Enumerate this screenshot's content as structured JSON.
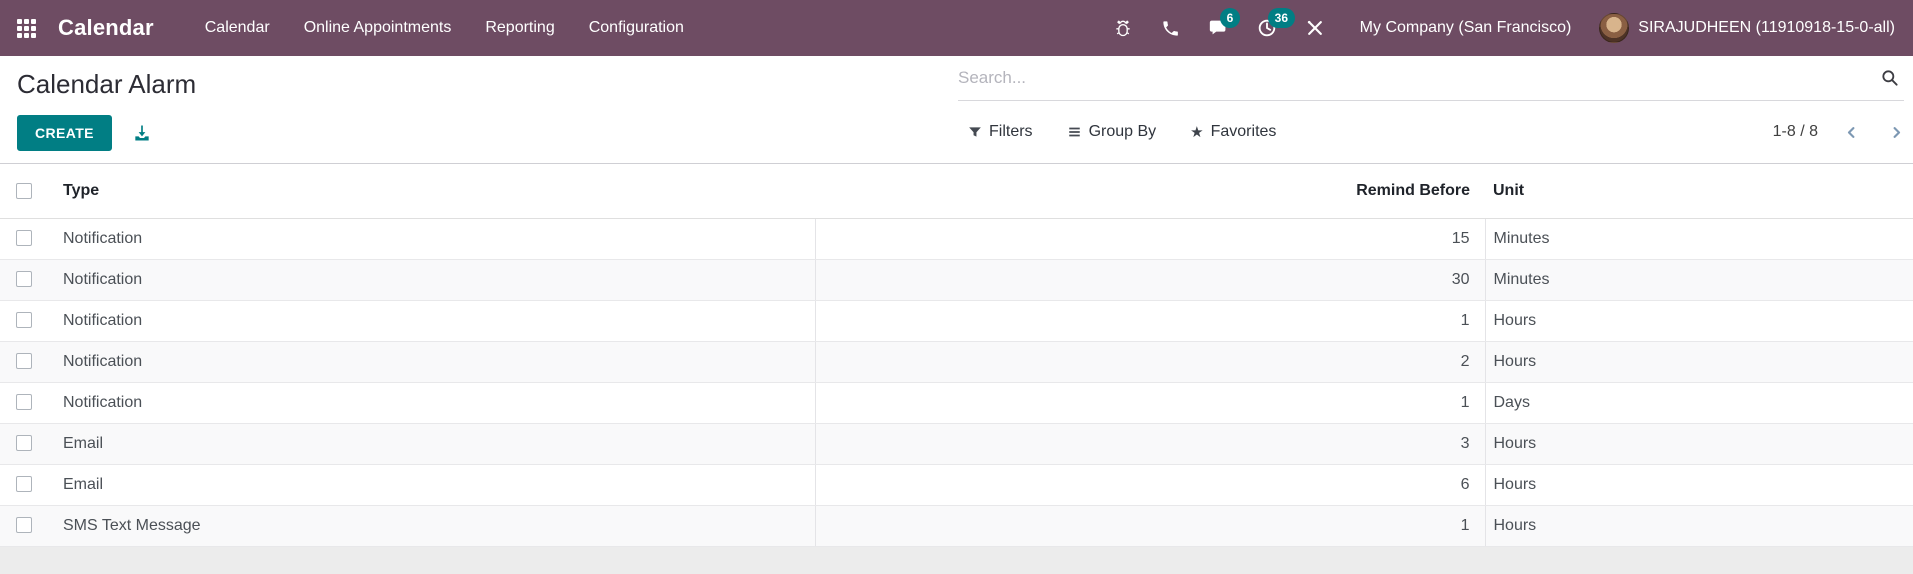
{
  "colors": {
    "navbar": "#6e4c63",
    "accent": "#017e84",
    "badge": "#017e84"
  },
  "navbar": {
    "app_name": "Calendar",
    "menu_items": [
      "Calendar",
      "Online Appointments",
      "Reporting",
      "Configuration"
    ],
    "icons": [
      "bug-icon",
      "phone-icon",
      "messages-icon",
      "activities-icon",
      "tools-icon"
    ],
    "messages_badge": "6",
    "activities_badge": "36",
    "company": "My Company (San Francisco)",
    "user": "SIRAJUDHEEN (11910918-15-0-all)"
  },
  "control_panel": {
    "title": "Calendar Alarm",
    "create_label": "CREATE",
    "search_placeholder": "Search...",
    "filters_label": "Filters",
    "group_by_label": "Group By",
    "favorites_label": "Favorites",
    "star_glyph": "★",
    "pager_value": "1-8 / 8"
  },
  "table": {
    "columns": {
      "type": "Type",
      "remind_before": "Remind Before",
      "unit": "Unit"
    },
    "rows": [
      {
        "type": "Notification",
        "remind_before": "15",
        "unit": "Minutes"
      },
      {
        "type": "Notification",
        "remind_before": "30",
        "unit": "Minutes"
      },
      {
        "type": "Notification",
        "remind_before": "1",
        "unit": "Hours"
      },
      {
        "type": "Notification",
        "remind_before": "2",
        "unit": "Hours"
      },
      {
        "type": "Notification",
        "remind_before": "1",
        "unit": "Days"
      },
      {
        "type": "Email",
        "remind_before": "3",
        "unit": "Hours"
      },
      {
        "type": "Email",
        "remind_before": "6",
        "unit": "Hours"
      },
      {
        "type": "SMS Text Message",
        "remind_before": "1",
        "unit": "Hours"
      }
    ]
  }
}
